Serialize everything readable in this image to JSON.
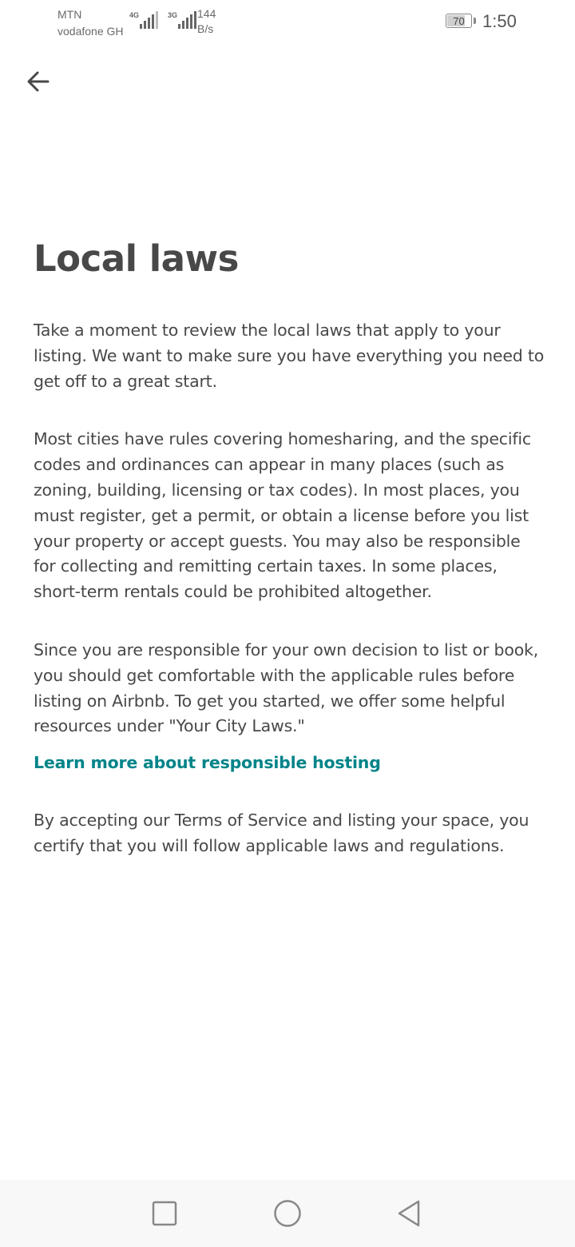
{
  "status_bar": {
    "carrier_1": "MTN",
    "carrier_2": "vodafone GH",
    "signal_1_type": "4G",
    "signal_2_type": "3G",
    "net_speed_value": "144",
    "net_speed_unit": "B/s",
    "battery_level": "70",
    "time": "1:50"
  },
  "header": {
    "back_icon": "arrow-left-icon"
  },
  "page": {
    "title": "Local laws",
    "paragraph_1": "Take a moment to review the local laws that apply to your listing. We want to make sure you have everything you need to get off to a great start.",
    "paragraph_2": "Most cities have rules covering homesharing, and the specific codes and ordinances can appear in many places (such as zoning, building, licensing or tax codes). In most places, you must register, get a permit, or obtain a license before you list your property or accept guests. You may also be responsible for collecting and remitting certain taxes. In some places, short-term rentals could be prohibited altogether.",
    "paragraph_3": "Since you are responsible for your own decision to list or book, you should get comfortable with the applicable rules before listing on Airbnb. To get you started, we offer some helpful resources under \"Your City Laws.\"",
    "learn_more_link": "Learn more about responsible hosting",
    "paragraph_4": "By accepting our Terms of Service and listing your space, you certify that you will follow applicable laws and regulations."
  },
  "nav_bar": {
    "recent_icon": "square-icon",
    "home_icon": "circle-icon",
    "back_icon": "triangle-back-icon"
  },
  "colors": {
    "text": "#484848",
    "link": "#008489",
    "background": "#ffffff",
    "nav_background": "#f8f8f8"
  }
}
